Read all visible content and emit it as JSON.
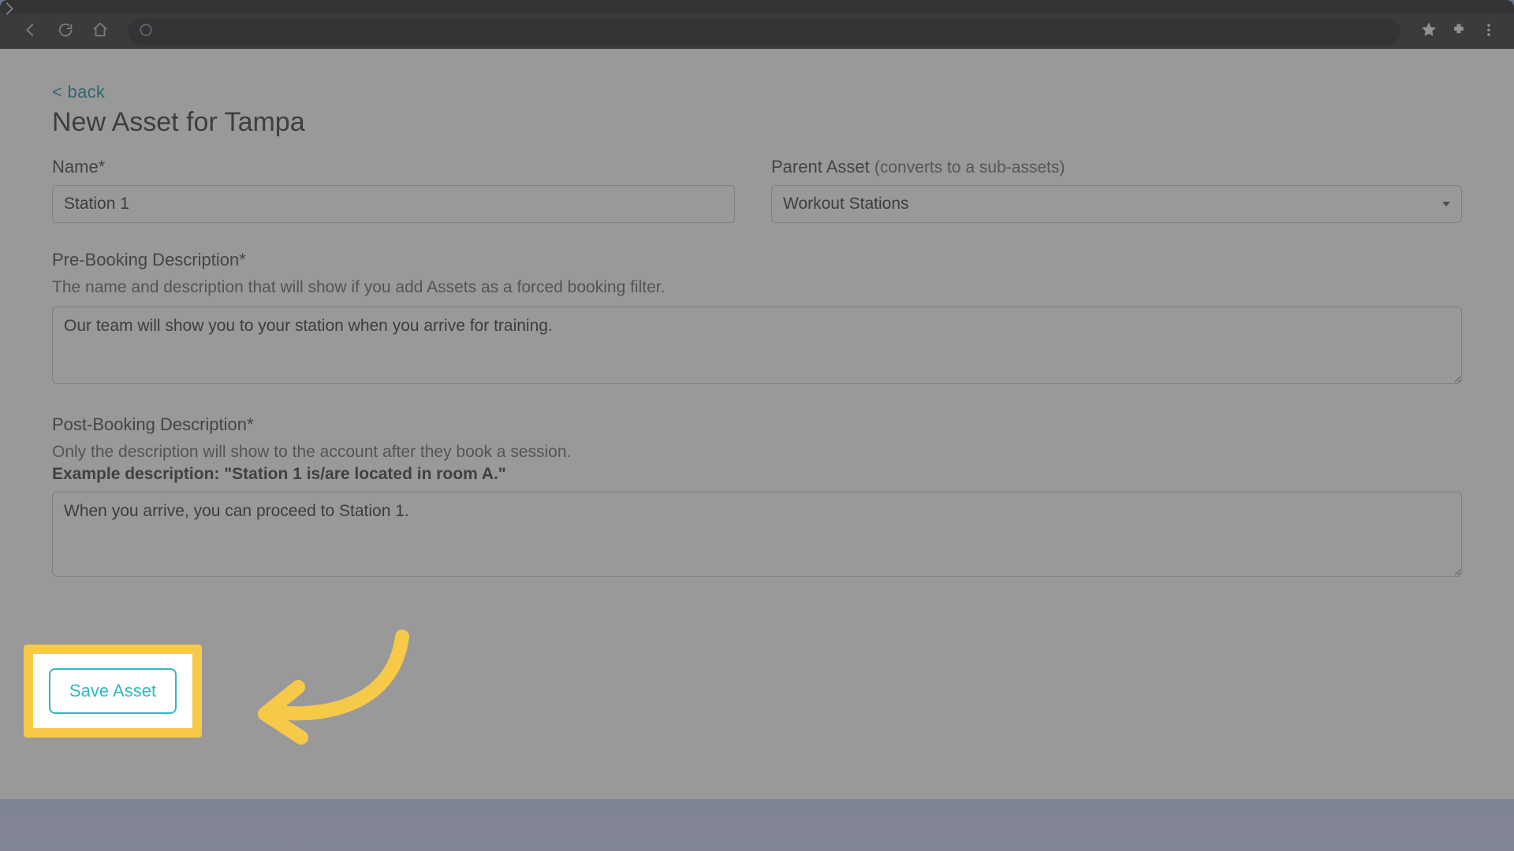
{
  "back_link": "< back",
  "page_title": "New Asset for Tampa",
  "fields": {
    "name": {
      "label": "Name*",
      "value": "Station 1"
    },
    "parent": {
      "label": "Parent Asset ",
      "hint": "(converts to a sub-assets)",
      "value": "Workout Stations"
    },
    "pre": {
      "label": "Pre-Booking Description*",
      "sub": "The name and description that will show if you add Assets as a forced booking filter.",
      "value": "Our team will show you to your station when you arrive for training."
    },
    "post": {
      "label": "Post-Booking Description*",
      "sub": "Only the description will show to the account after they book a session.",
      "example": "Example description: \"Station 1 is/are located in room A.\"",
      "value": "When you arrive, you can proceed to Station 1."
    }
  },
  "save_label": "Save Asset"
}
